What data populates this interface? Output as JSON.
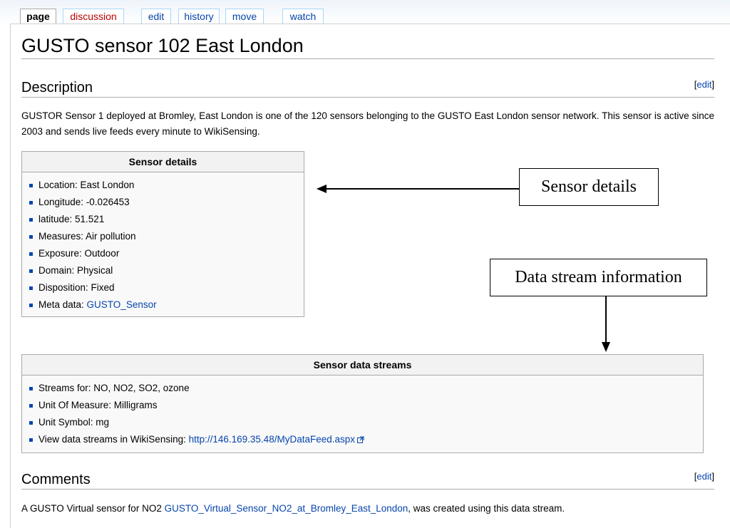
{
  "tabs": [
    "page",
    "discussion",
    "edit",
    "history",
    "move",
    "watch"
  ],
  "title": "GUSTO sensor 102 East London",
  "description": {
    "heading": "Description",
    "edit": "edit",
    "text": "GUSTOR Sensor 1 deployed at Bromley, East London is one of the 120 sensors belonging to the GUSTO East London sensor network. This sensor is active since 2003 and sends live feeds every minute to WikiSensing."
  },
  "sensor_details": {
    "heading": "Sensor details",
    "items": [
      "Location: East London",
      "Longitude: -0.026453",
      "latitude: 51.521",
      "Measures: Air pollution",
      "Exposure: Outdoor",
      "Domain: Physical",
      "Disposition: Fixed"
    ],
    "meta_label": "Meta data: ",
    "meta_link": "GUSTO_Sensor"
  },
  "streams": {
    "heading": "Sensor data streams",
    "items": [
      "Streams for: NO, NO2, SO2, ozone",
      "Unit Of Measure: Milligrams",
      "Unit Symbol: mg"
    ],
    "view_label": "View data streams in WikiSensing: ",
    "view_link": "http://146.169.35.48/MyDataFeed.aspx"
  },
  "comments": {
    "heading": "Comments",
    "edit": "edit",
    "prefix": "A GUSTO Virtual sensor for NO2 ",
    "link": "GUSTO_Virtual_Sensor_NO2_at_Bromley_East_London",
    "suffix": ", was created using this data stream."
  },
  "callouts": {
    "sensor_details": "Sensor details",
    "data_stream": "Data stream information"
  }
}
